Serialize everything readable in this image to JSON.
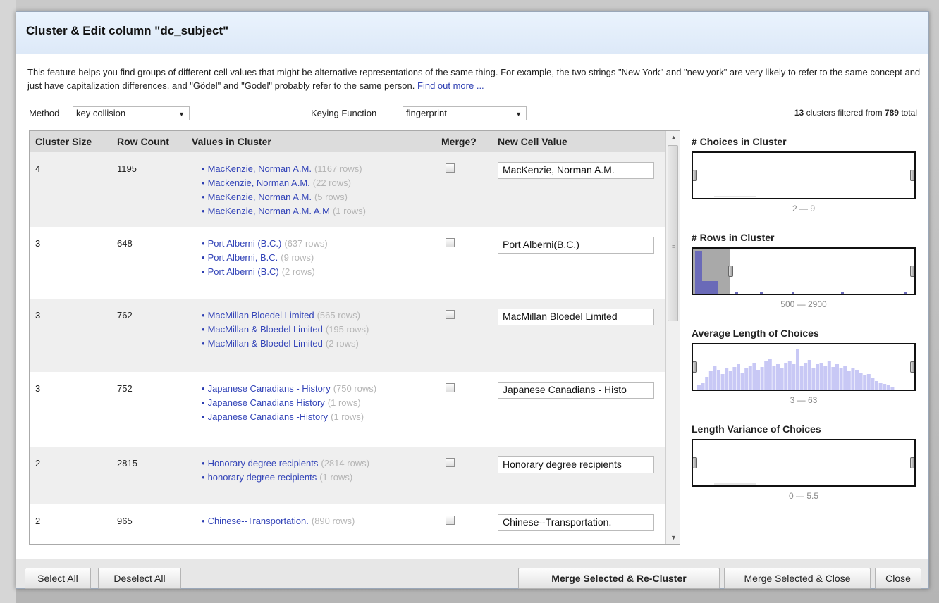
{
  "dialog": {
    "title": "Cluster & Edit column \"dc_subject\"",
    "intro": "This feature helps you find groups of different cell values that might be alternative representations of the same thing. For example, the two strings \"New York\" and \"new york\" are very likely to refer to the same concept and just have capitalization differences, and \"Gödel\" and \"Godel\" probably refer to the same person.",
    "find_out_more": "Find out more ..."
  },
  "controls": {
    "method_label": "Method",
    "method_value": "key collision",
    "keying_label": "Keying Function",
    "keying_value": "fingerprint",
    "cluster_count": "13",
    "filtered_text": "clusters filtered from",
    "total_count": "789",
    "total_text": "total"
  },
  "table": {
    "headers": {
      "cluster_size": "Cluster Size",
      "row_count": "Row Count",
      "values": "Values in Cluster",
      "merge": "Merge?",
      "new_value": "New Cell Value"
    },
    "rows": [
      {
        "size": "4",
        "count": "1195",
        "new_value": "MacKenzie, Norman A.M.",
        "values": [
          {
            "text": "MacKenzie, Norman A.M.",
            "rows": "(1167 rows)"
          },
          {
            "text": "Mackenzie, Norman A.M.",
            "rows": "(22 rows)"
          },
          {
            "text": "MacKenzie, Norman A.M.",
            "rows": "(5 rows)"
          },
          {
            "text": "MacKenzie, Norman A.M. A.M",
            "rows": "(1 rows)"
          }
        ]
      },
      {
        "size": "3",
        "count": "648",
        "new_value": "Port Alberni(B.C.)",
        "values": [
          {
            "text": "Port Alberni (B.C.)",
            "rows": "(637 rows)"
          },
          {
            "text": "Port Alberni, B.C.",
            "rows": "(9 rows)"
          },
          {
            "text": "Port Alberni (B.C)",
            "rows": "(2 rows)"
          }
        ]
      },
      {
        "size": "3",
        "count": "762",
        "new_value": "MacMillan Bloedel Limited",
        "values": [
          {
            "text": "MacMillan Bloedel Limited",
            "rows": "(565 rows)"
          },
          {
            "text": "MacMillan & Bloedel Limited",
            "rows": "(195 rows)"
          },
          {
            "text": "MacMillan & Bloedel Limited",
            "rows": "(2 rows)"
          }
        ]
      },
      {
        "size": "3",
        "count": "752",
        "new_value": "Japanese Canadians - Histo",
        "values": [
          {
            "text": "Japanese Canadians - History",
            "rows": "(750 rows)"
          },
          {
            "text": "Japanese Canadians History",
            "rows": "(1 rows)"
          },
          {
            "text": "Japanese Canadians -History",
            "rows": "(1 rows)"
          }
        ]
      },
      {
        "size": "2",
        "count": "2815",
        "new_value": "Honorary degree recipients",
        "values": [
          {
            "text": "Honorary degree recipients",
            "rows": "(2814 rows)"
          },
          {
            "text": "honorary degree recipients",
            "rows": "(1 rows)"
          }
        ]
      },
      {
        "size": "2",
        "count": "965",
        "new_value": "Chinese--Transportation.",
        "values": [
          {
            "text": "Chinese--Transportation.",
            "rows": "(890 rows)"
          }
        ]
      }
    ]
  },
  "facets": [
    {
      "title": "# Choices in Cluster",
      "range": "2 — 9"
    },
    {
      "title": "# Rows in Cluster",
      "range": "500 — 2900"
    },
    {
      "title": "Average Length of Choices",
      "range": "3 — 63"
    },
    {
      "title": "Length Variance of Choices",
      "range": "0 — 5.5"
    }
  ],
  "footer": {
    "select_all": "Select All",
    "deselect_all": "Deselect All",
    "merge_recluster": "Merge Selected & Re-Cluster",
    "merge_close": "Merge Selected & Close",
    "close": "Close"
  },
  "colors": {
    "link": "#3344b8",
    "histogram_fill": "#c8c8f5",
    "histogram_dark": "#6a6ab8"
  }
}
